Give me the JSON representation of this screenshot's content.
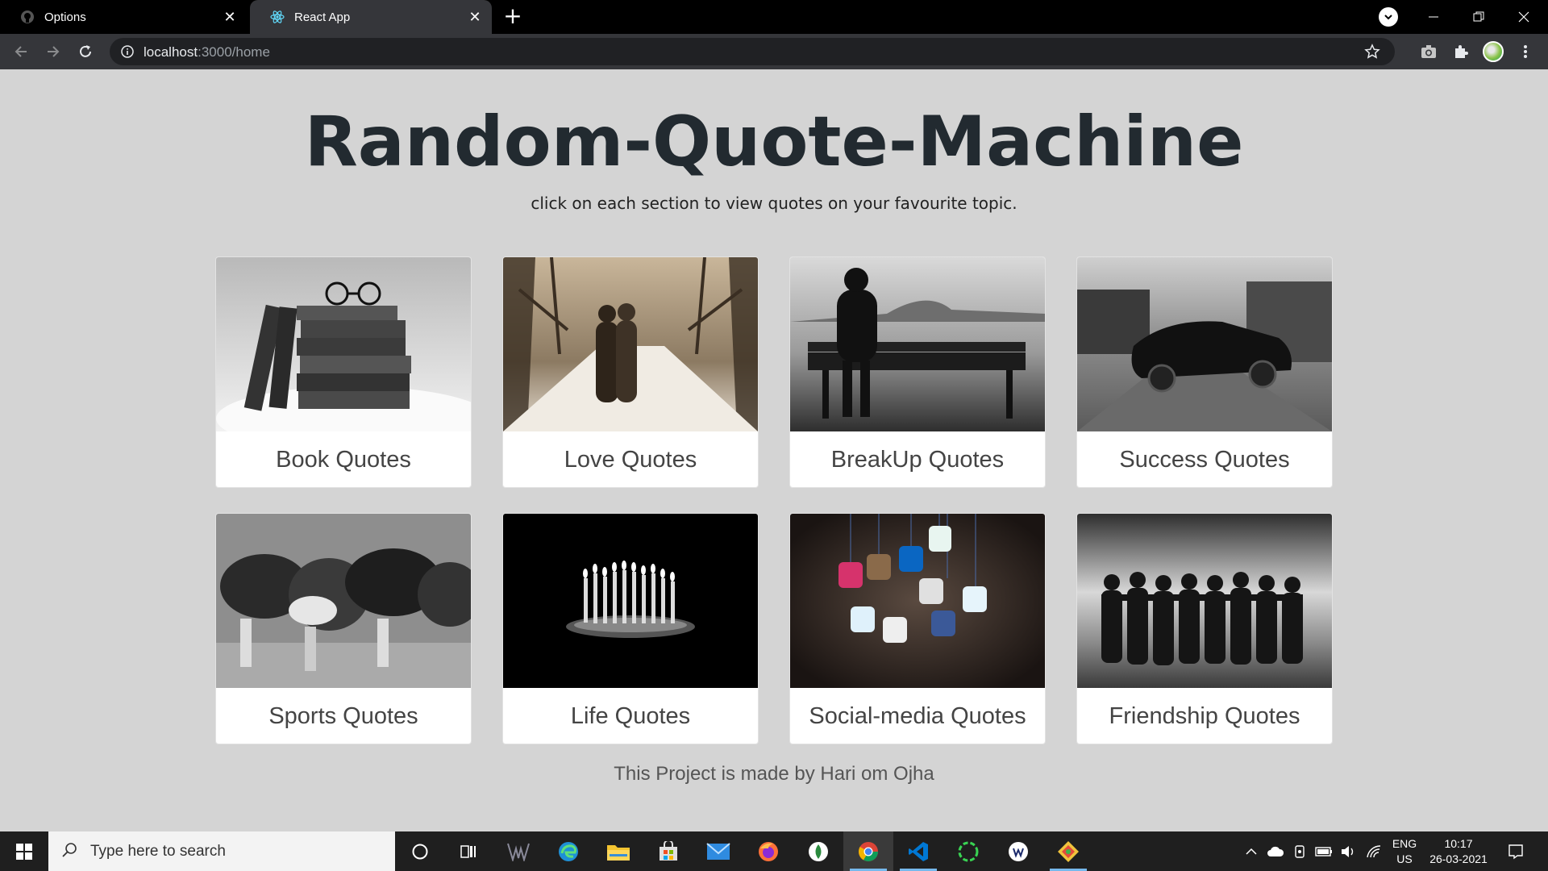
{
  "browser": {
    "tabs": [
      {
        "title": "Options",
        "icon": "github-icon"
      },
      {
        "title": "React App",
        "icon": "react-icon"
      }
    ],
    "url_host": "localhost",
    "url_path": ":3000/home"
  },
  "page": {
    "heading": "Random-Quote-Machine",
    "subtitle": "click on each section to view quotes on your favourite topic.",
    "cards": [
      {
        "label": "Book Quotes"
      },
      {
        "label": "Love Quotes"
      },
      {
        "label": "BreakUp Quotes"
      },
      {
        "label": "Success Quotes"
      },
      {
        "label": "Sports Quotes"
      },
      {
        "label": "Life Quotes"
      },
      {
        "label": "Social-media Quotes"
      },
      {
        "label": "Friendship Quotes"
      }
    ],
    "footer": "This Project is made by Hari om Ojha"
  },
  "taskbar": {
    "search_placeholder": "Type here to search",
    "lang_line1": "ENG",
    "lang_line2": "US",
    "time": "10:17",
    "date": "26-03-2021"
  },
  "colors": {
    "page_bg": "#d4d4d4",
    "heading": "#222a30",
    "tab_active": "#35363a",
    "taskbar": "#1f1f1f"
  }
}
